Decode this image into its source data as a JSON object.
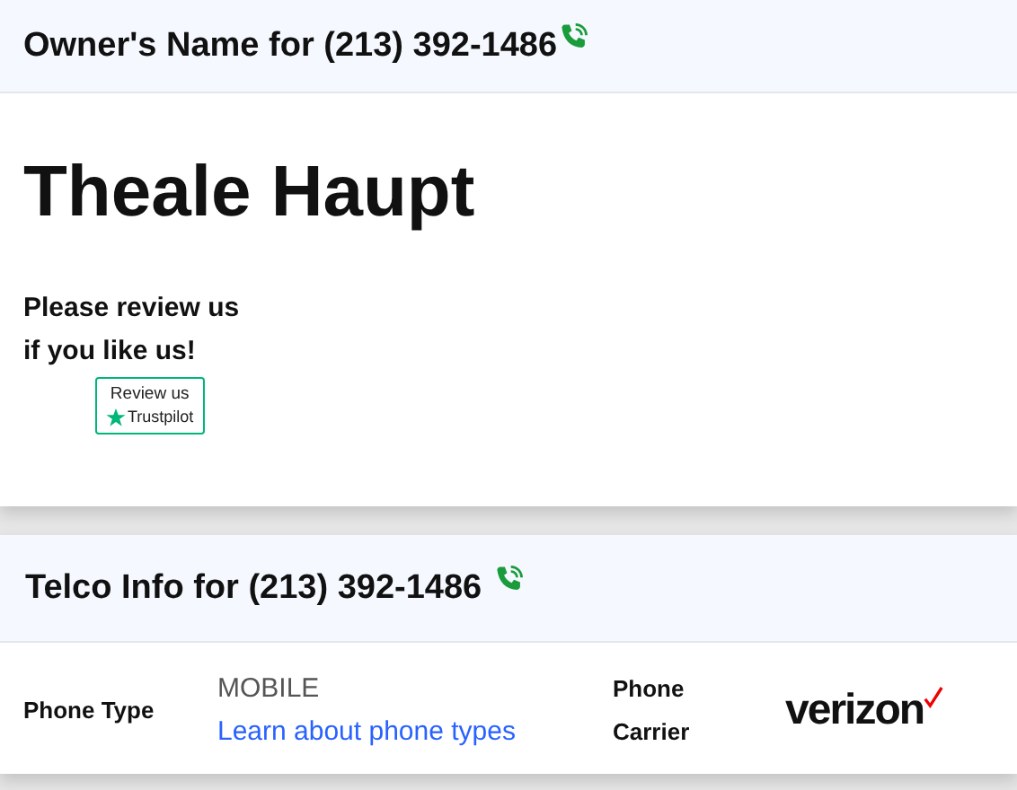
{
  "owner_section": {
    "title": "Owner's Name for (213) 392-1486",
    "owner_name": "Theale Haupt",
    "review_prompt": "Please review us if you like us!",
    "review_widget": {
      "label": "Review us",
      "brand": "Trustpilot"
    }
  },
  "telco_section": {
    "title": "Telco Info for (213) 392-1486",
    "phone_type": {
      "label": "Phone Type",
      "value": "MOBILE",
      "link": "Learn about phone types"
    },
    "carrier": {
      "label": "Phone Carrier",
      "logo_text": "verizon"
    }
  }
}
